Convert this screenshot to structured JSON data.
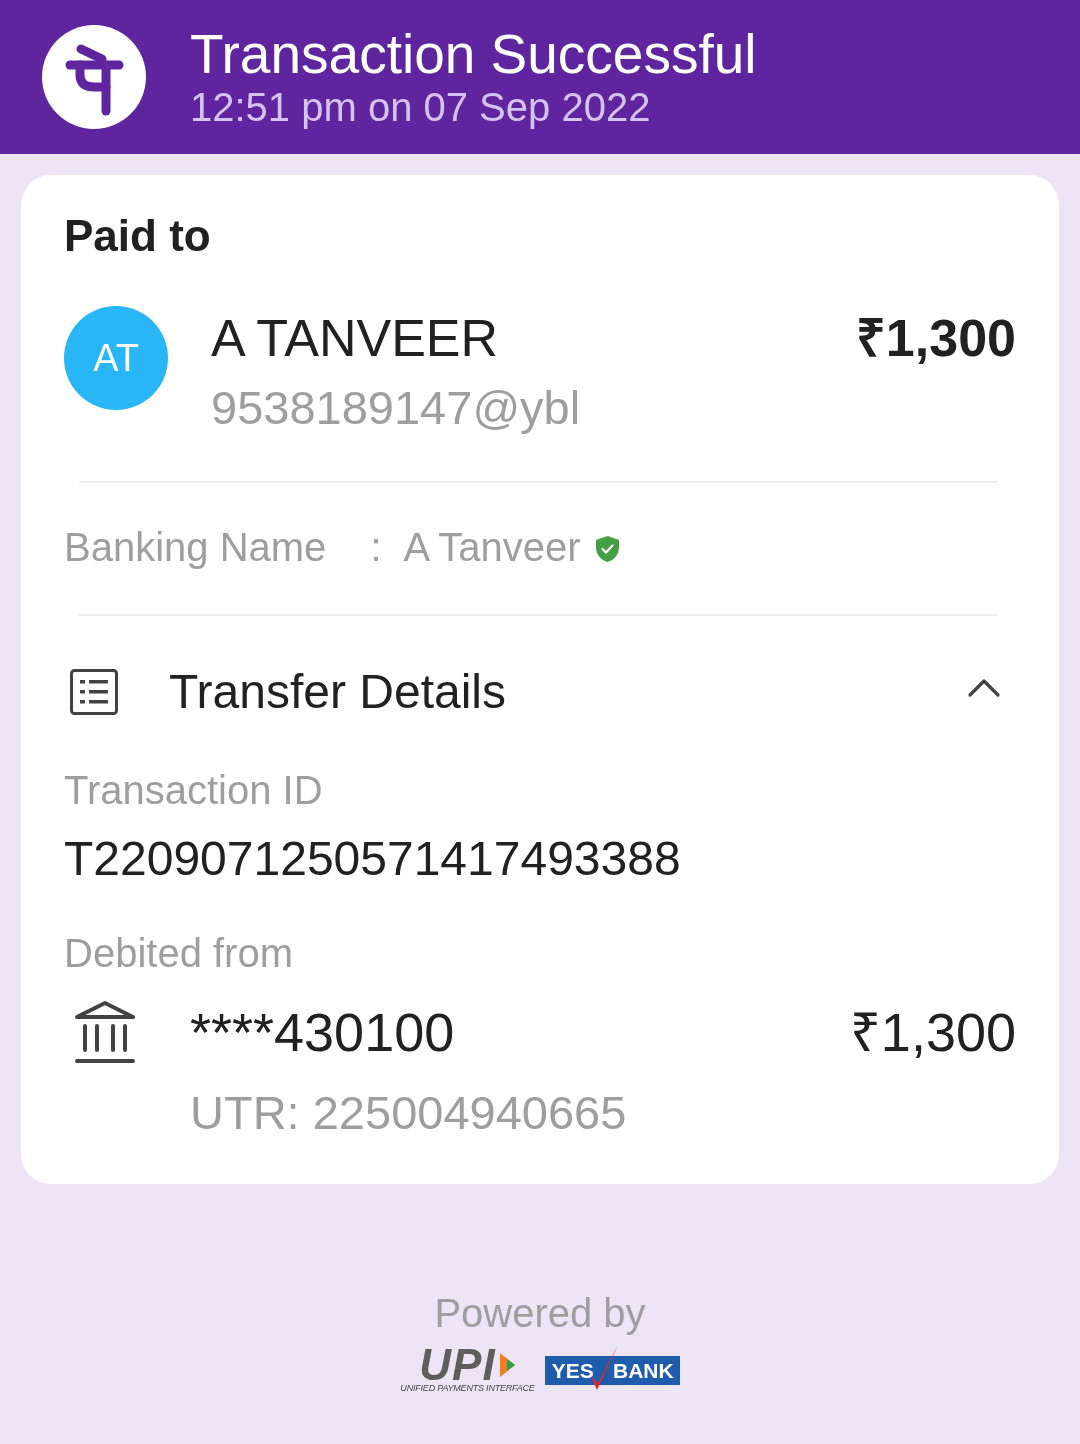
{
  "header": {
    "title": "Transaction Successful",
    "timestamp": "12:51 pm on 07 Sep 2022"
  },
  "paid_to": {
    "heading": "Paid to",
    "initials": "AT",
    "name": "A TANVEER",
    "upi_id": "9538189147@ybl",
    "amount": "₹1,300"
  },
  "banking_name": {
    "label": "Banking Name",
    "separator": ":",
    "value": "A Tanveer",
    "verified": true
  },
  "transfer_details": {
    "title": "Transfer Details",
    "expanded": true,
    "fields": [
      {
        "kind": "id",
        "label": "Transaction ID",
        "value": "T2209071250571417493388"
      },
      {
        "kind": "account",
        "label": "Debited from",
        "value": "****430100",
        "amount": "₹1,300",
        "reference": "UTR: 225004940665"
      }
    ]
  },
  "footer": {
    "caption": "Powered by",
    "logos": [
      {
        "kind": "upi",
        "wordmark": "UPI",
        "tagline": "UNIFIED PAYMENTS INTERFACE"
      },
      {
        "kind": "bank",
        "words": [
          "YES",
          "BANK"
        ]
      }
    ]
  }
}
